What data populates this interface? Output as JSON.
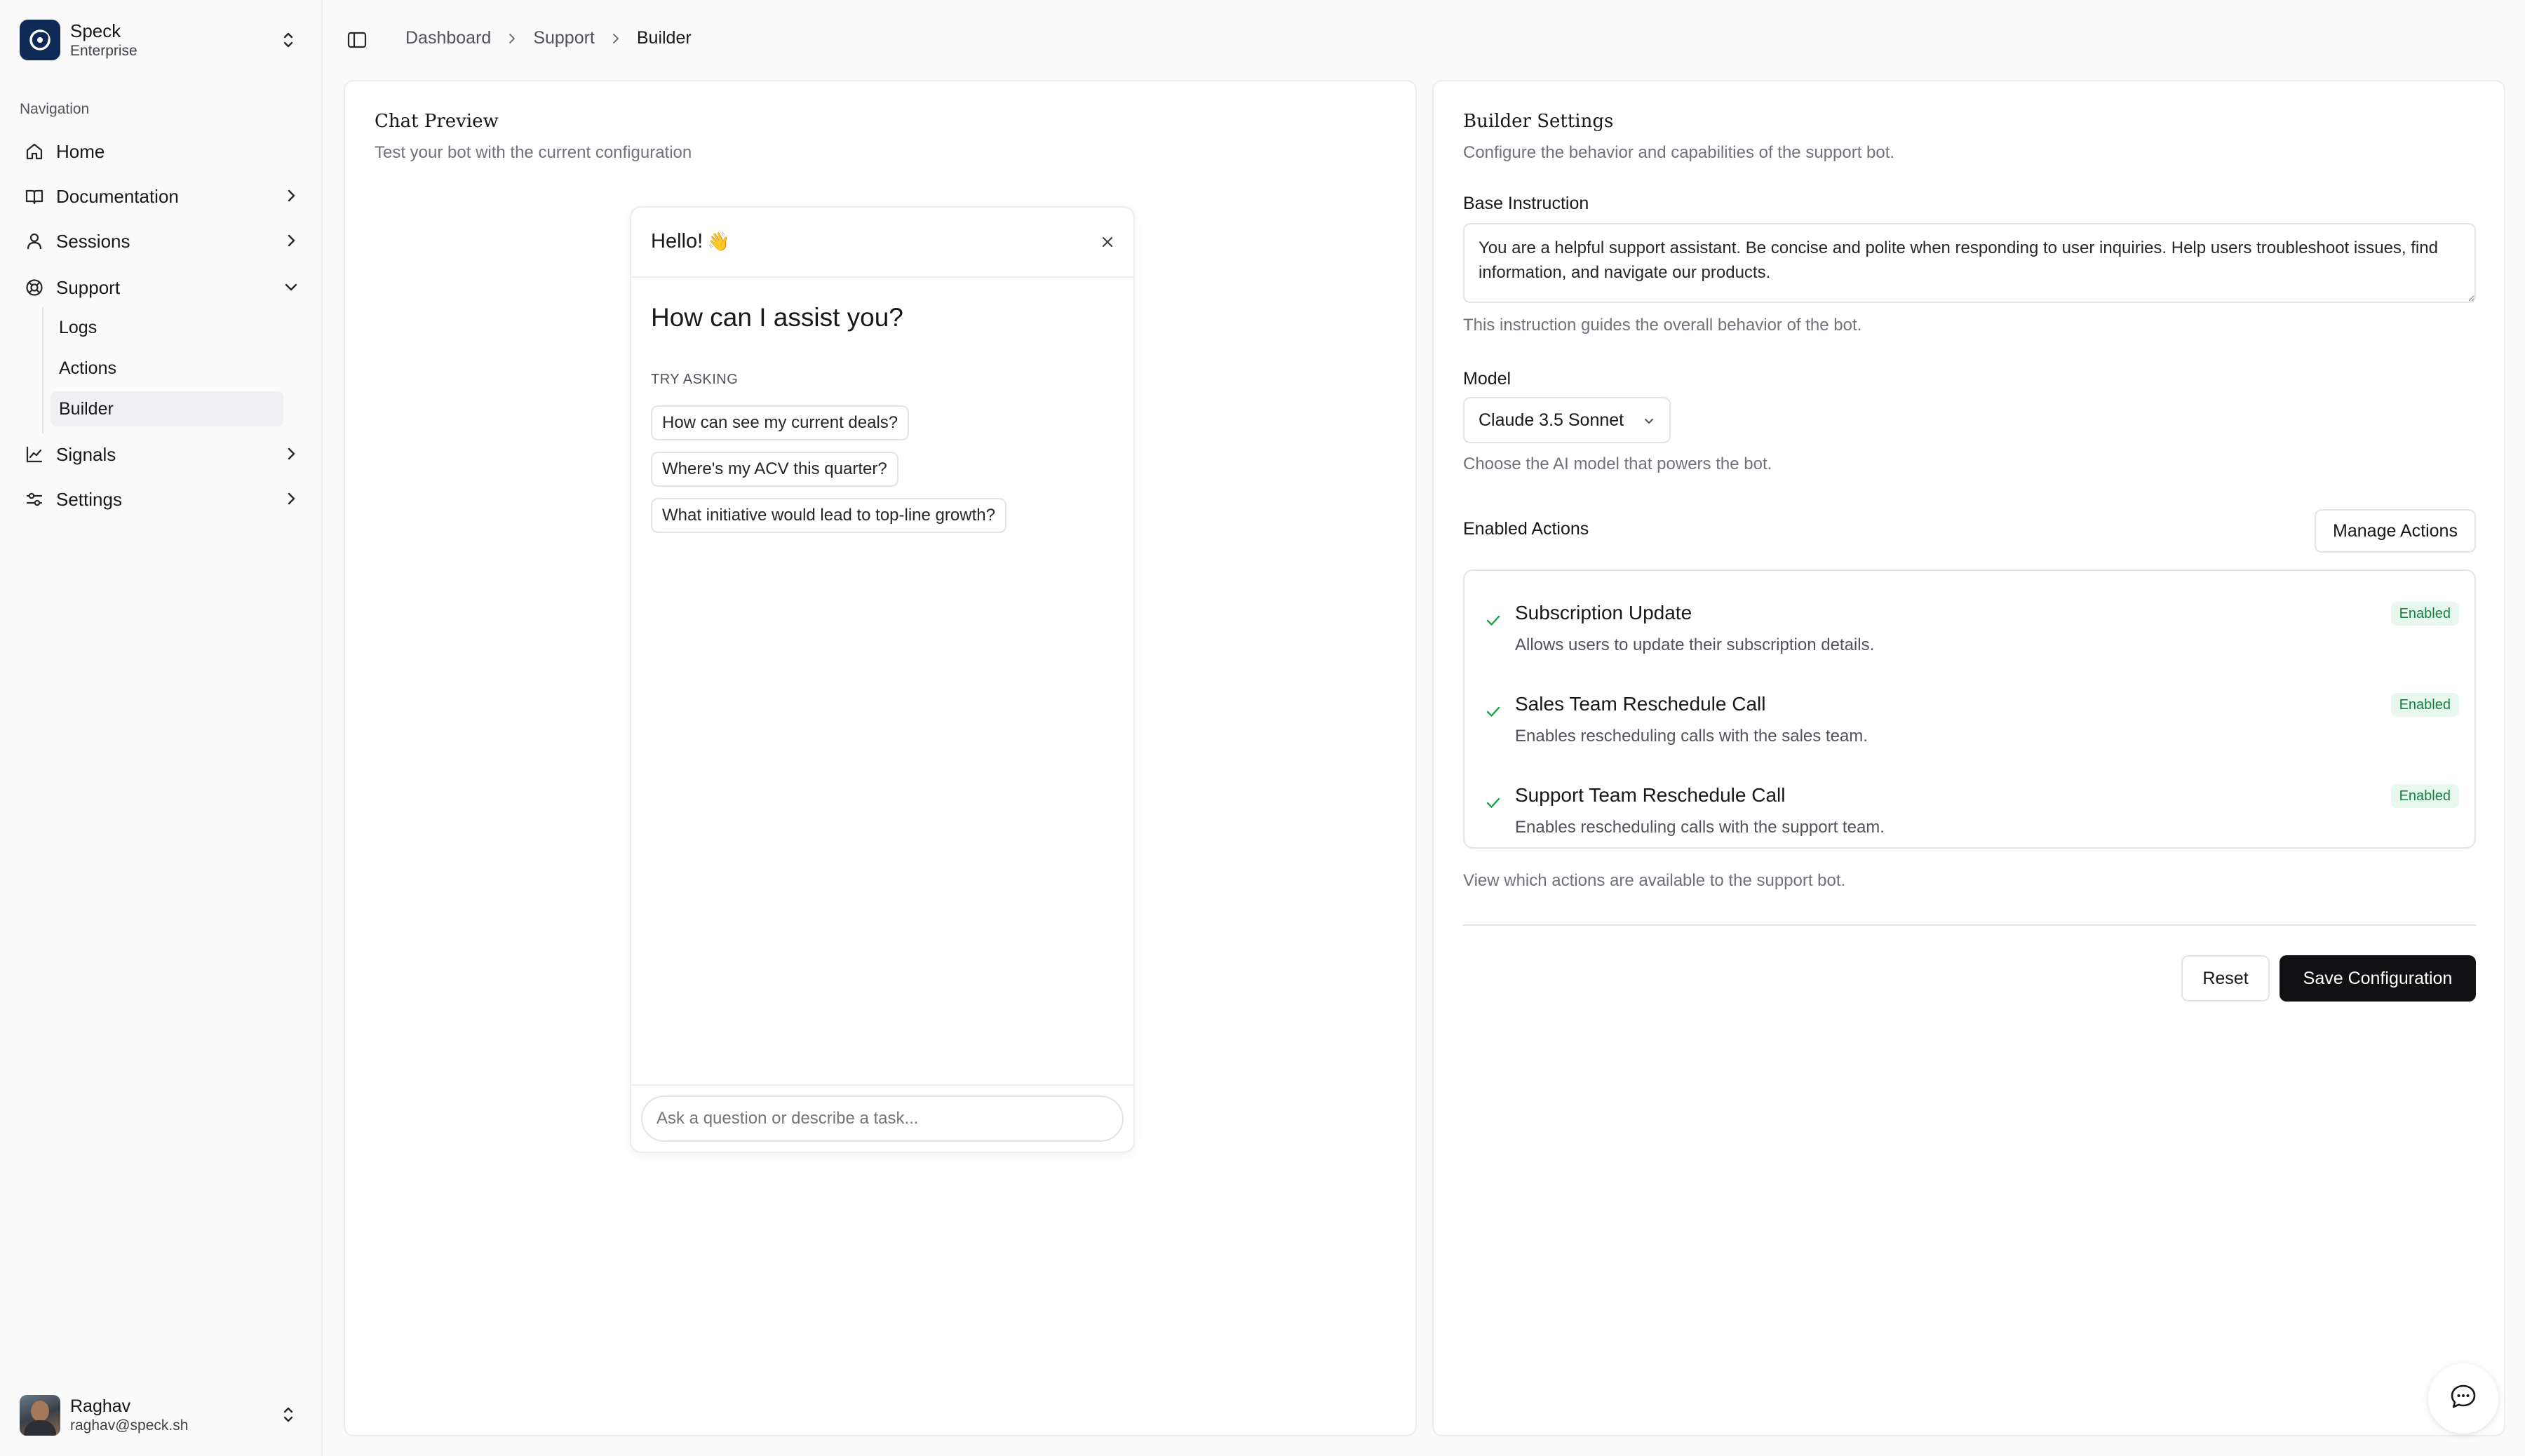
{
  "workspace": {
    "name": "Speck",
    "plan": "Enterprise"
  },
  "nav": {
    "section_label": "Navigation",
    "items": [
      {
        "label": "Home",
        "icon": "home-icon"
      },
      {
        "label": "Documentation",
        "icon": "book-icon"
      },
      {
        "label": "Sessions",
        "icon": "user-icon"
      },
      {
        "label": "Support",
        "icon": "lifebuoy-icon"
      },
      {
        "label": "Signals",
        "icon": "chart-icon"
      },
      {
        "label": "Settings",
        "icon": "sliders-icon"
      }
    ],
    "support_sub": [
      "Logs",
      "Actions",
      "Builder"
    ],
    "active_sub": "Builder"
  },
  "user": {
    "name": "Raghav",
    "email": "raghav@speck.sh"
  },
  "breadcrumb": [
    "Dashboard",
    "Support",
    "Builder"
  ],
  "chat_preview": {
    "title": "Chat Preview",
    "subtitle": "Test your bot with the current configuration",
    "greeting": "Hello!",
    "greeting_emoji": "👋",
    "question": "How can I assist you?",
    "try_label": "TRY ASKING",
    "suggestions": [
      "How can see my current deals?",
      "Where's my ACV this quarter?",
      "What initiative would lead to top-line growth?"
    ],
    "input_placeholder": "Ask a question or describe a task..."
  },
  "builder": {
    "title": "Builder Settings",
    "subtitle": "Configure the behavior and capabilities of the support bot.",
    "base_instruction_label": "Base Instruction",
    "base_instruction_value": "You are a helpful support assistant. Be concise and polite when responding to user inquiries. Help users troubleshoot issues, find information, and navigate our products.",
    "base_instruction_help": "This instruction guides the overall behavior of the bot.",
    "model_label": "Model",
    "model_value": "Claude 3.5 Sonnet",
    "model_help": "Choose the AI model that powers the bot.",
    "enabled_actions_label": "Enabled Actions",
    "manage_actions_label": "Manage Actions",
    "actions": [
      {
        "title": "Subscription Update",
        "desc": "Allows users to update their subscription details.",
        "status": "Enabled"
      },
      {
        "title": "Sales Team Reschedule Call",
        "desc": "Enables rescheduling calls with the sales team.",
        "status": "Enabled"
      },
      {
        "title": "Support Team Reschedule Call",
        "desc": "Enables rescheduling calls with the support team.",
        "status": "Enabled"
      }
    ],
    "actions_help": "View which actions are available to the support bot.",
    "reset_label": "Reset",
    "save_label": "Save Configuration"
  },
  "colors": {
    "accent_dark": "#111113",
    "enabled_badge_bg": "#e9f8ee",
    "enabled_badge_text": "#15803d",
    "brand_logo": "#0f2a55"
  }
}
